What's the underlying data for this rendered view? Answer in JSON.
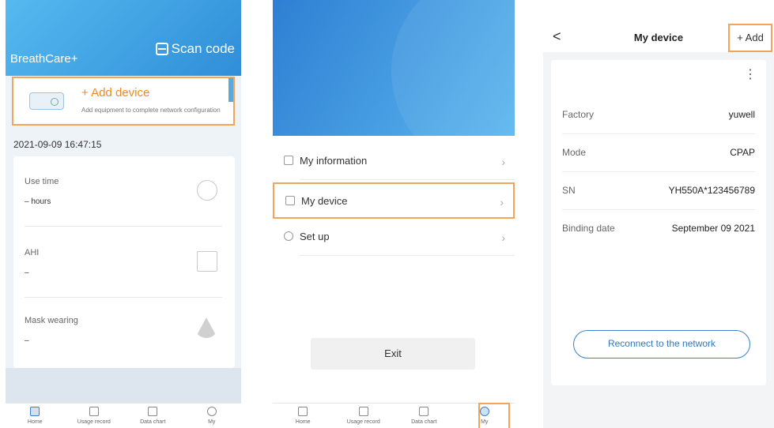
{
  "s1": {
    "brand": "BreathCare+",
    "scan": "Scan code",
    "add_title": "+ Add device",
    "add_sub": "Add equipment to complete network configuration",
    "datetime": "2021-09-09 16:47:15",
    "stats": [
      {
        "label": "Use time",
        "value": "– hours"
      },
      {
        "label": "AHI",
        "value": "–"
      },
      {
        "label": "Mask wearing",
        "value": "–"
      }
    ]
  },
  "tabs": [
    "Home",
    "Usage record",
    "Data chart",
    "My"
  ],
  "s2": {
    "menu": [
      "My information",
      "My device",
      "Set up"
    ],
    "exit": "Exit"
  },
  "s3": {
    "back": "<",
    "title": "My device",
    "add": "+ Add",
    "more": "⋮",
    "rows": [
      {
        "k": "Factory",
        "v": "yuwell"
      },
      {
        "k": "Mode",
        "v": "CPAP"
      },
      {
        "k": "SN",
        "v": "YH550A*123456789"
      },
      {
        "k": "Binding date",
        "v": "September 09 2021"
      }
    ],
    "reconnect": "Reconnect to the network"
  },
  "colors": {
    "accent": "#f0a55b",
    "primary": "#2f8ed8"
  }
}
